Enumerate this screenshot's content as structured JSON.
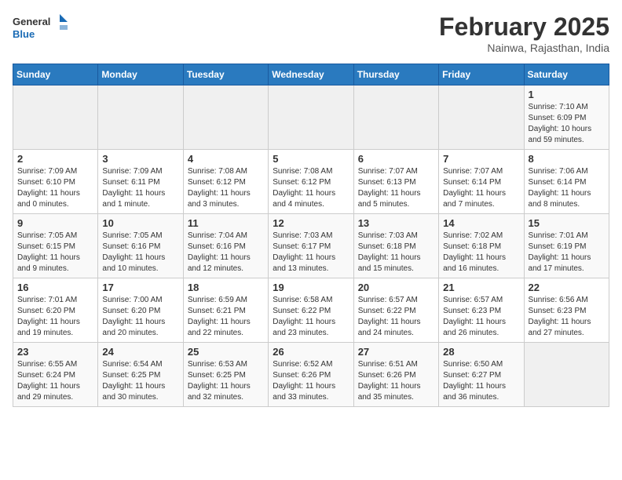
{
  "header": {
    "logo_general": "General",
    "logo_blue": "Blue",
    "month_title": "February 2025",
    "subtitle": "Nainwa, Rajasthan, India"
  },
  "days_of_week": [
    "Sunday",
    "Monday",
    "Tuesday",
    "Wednesday",
    "Thursday",
    "Friday",
    "Saturday"
  ],
  "weeks": [
    [
      {
        "day": "",
        "info": ""
      },
      {
        "day": "",
        "info": ""
      },
      {
        "day": "",
        "info": ""
      },
      {
        "day": "",
        "info": ""
      },
      {
        "day": "",
        "info": ""
      },
      {
        "day": "",
        "info": ""
      },
      {
        "day": "1",
        "info": "Sunrise: 7:10 AM\nSunset: 6:09 PM\nDaylight: 10 hours\nand 59 minutes."
      }
    ],
    [
      {
        "day": "2",
        "info": "Sunrise: 7:09 AM\nSunset: 6:10 PM\nDaylight: 11 hours\nand 0 minutes."
      },
      {
        "day": "3",
        "info": "Sunrise: 7:09 AM\nSunset: 6:11 PM\nDaylight: 11 hours\nand 1 minute."
      },
      {
        "day": "4",
        "info": "Sunrise: 7:08 AM\nSunset: 6:12 PM\nDaylight: 11 hours\nand 3 minutes."
      },
      {
        "day": "5",
        "info": "Sunrise: 7:08 AM\nSunset: 6:12 PM\nDaylight: 11 hours\nand 4 minutes."
      },
      {
        "day": "6",
        "info": "Sunrise: 7:07 AM\nSunset: 6:13 PM\nDaylight: 11 hours\nand 5 minutes."
      },
      {
        "day": "7",
        "info": "Sunrise: 7:07 AM\nSunset: 6:14 PM\nDaylight: 11 hours\nand 7 minutes."
      },
      {
        "day": "8",
        "info": "Sunrise: 7:06 AM\nSunset: 6:14 PM\nDaylight: 11 hours\nand 8 minutes."
      }
    ],
    [
      {
        "day": "9",
        "info": "Sunrise: 7:05 AM\nSunset: 6:15 PM\nDaylight: 11 hours\nand 9 minutes."
      },
      {
        "day": "10",
        "info": "Sunrise: 7:05 AM\nSunset: 6:16 PM\nDaylight: 11 hours\nand 10 minutes."
      },
      {
        "day": "11",
        "info": "Sunrise: 7:04 AM\nSunset: 6:16 PM\nDaylight: 11 hours\nand 12 minutes."
      },
      {
        "day": "12",
        "info": "Sunrise: 7:03 AM\nSunset: 6:17 PM\nDaylight: 11 hours\nand 13 minutes."
      },
      {
        "day": "13",
        "info": "Sunrise: 7:03 AM\nSunset: 6:18 PM\nDaylight: 11 hours\nand 15 minutes."
      },
      {
        "day": "14",
        "info": "Sunrise: 7:02 AM\nSunset: 6:18 PM\nDaylight: 11 hours\nand 16 minutes."
      },
      {
        "day": "15",
        "info": "Sunrise: 7:01 AM\nSunset: 6:19 PM\nDaylight: 11 hours\nand 17 minutes."
      }
    ],
    [
      {
        "day": "16",
        "info": "Sunrise: 7:01 AM\nSunset: 6:20 PM\nDaylight: 11 hours\nand 19 minutes."
      },
      {
        "day": "17",
        "info": "Sunrise: 7:00 AM\nSunset: 6:20 PM\nDaylight: 11 hours\nand 20 minutes."
      },
      {
        "day": "18",
        "info": "Sunrise: 6:59 AM\nSunset: 6:21 PM\nDaylight: 11 hours\nand 22 minutes."
      },
      {
        "day": "19",
        "info": "Sunrise: 6:58 AM\nSunset: 6:22 PM\nDaylight: 11 hours\nand 23 minutes."
      },
      {
        "day": "20",
        "info": "Sunrise: 6:57 AM\nSunset: 6:22 PM\nDaylight: 11 hours\nand 24 minutes."
      },
      {
        "day": "21",
        "info": "Sunrise: 6:57 AM\nSunset: 6:23 PM\nDaylight: 11 hours\nand 26 minutes."
      },
      {
        "day": "22",
        "info": "Sunrise: 6:56 AM\nSunset: 6:23 PM\nDaylight: 11 hours\nand 27 minutes."
      }
    ],
    [
      {
        "day": "23",
        "info": "Sunrise: 6:55 AM\nSunset: 6:24 PM\nDaylight: 11 hours\nand 29 minutes."
      },
      {
        "day": "24",
        "info": "Sunrise: 6:54 AM\nSunset: 6:25 PM\nDaylight: 11 hours\nand 30 minutes."
      },
      {
        "day": "25",
        "info": "Sunrise: 6:53 AM\nSunset: 6:25 PM\nDaylight: 11 hours\nand 32 minutes."
      },
      {
        "day": "26",
        "info": "Sunrise: 6:52 AM\nSunset: 6:26 PM\nDaylight: 11 hours\nand 33 minutes."
      },
      {
        "day": "27",
        "info": "Sunrise: 6:51 AM\nSunset: 6:26 PM\nDaylight: 11 hours\nand 35 minutes."
      },
      {
        "day": "28",
        "info": "Sunrise: 6:50 AM\nSunset: 6:27 PM\nDaylight: 11 hours\nand 36 minutes."
      },
      {
        "day": "",
        "info": ""
      }
    ]
  ]
}
